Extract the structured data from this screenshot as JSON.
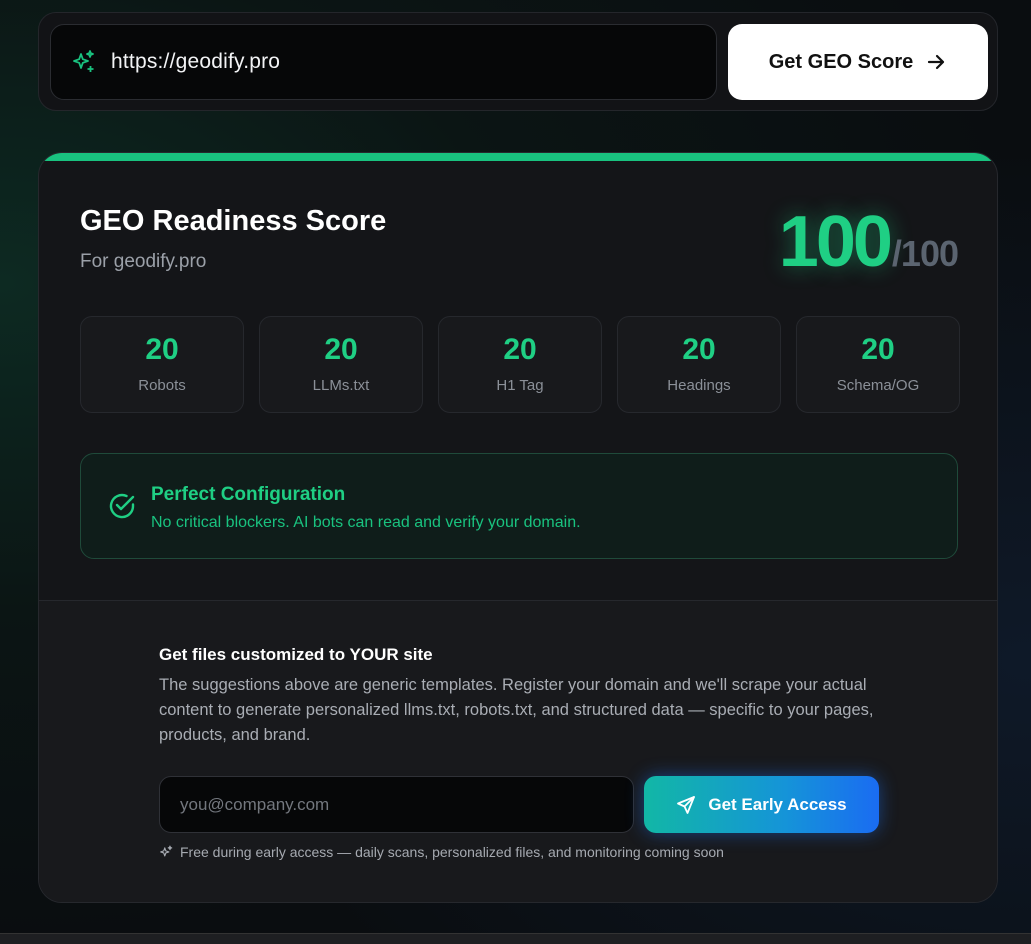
{
  "url_bar": {
    "value": "https://geodify.pro",
    "icon": "sparkle-icon",
    "button_label": "Get GEO Score",
    "button_icon": "arrow-right-icon"
  },
  "score_card": {
    "accent_color": "#19c27f",
    "title": "GEO Readiness Score",
    "subtitle": "For geodify.pro",
    "score": "100",
    "score_max": "/100",
    "metrics": [
      {
        "value": "20",
        "label": "Robots"
      },
      {
        "value": "20",
        "label": "LLMs.txt"
      },
      {
        "value": "20",
        "label": "H1 Tag"
      },
      {
        "value": "20",
        "label": "Headings"
      },
      {
        "value": "20",
        "label": "Schema/OG"
      }
    ],
    "status": {
      "icon": "check-circle-icon",
      "title": "Perfect Configuration",
      "description": "No critical blockers. AI bots can read and verify your domain."
    }
  },
  "early_access": {
    "title": "Get files customized to YOUR site",
    "body": "The suggestions above are generic templates. Register your domain and we'll scrape your actual content to generate personalized llms.txt, robots.txt, and structured data — specific to your pages, products, and brand.",
    "email_placeholder": "you@company.com",
    "button_label": "Get Early Access",
    "button_icon": "send-icon",
    "footnote": "Free during early access — daily scans, personalized files, and monitoring coming soon",
    "footnote_icon": "sparkle-icon"
  }
}
